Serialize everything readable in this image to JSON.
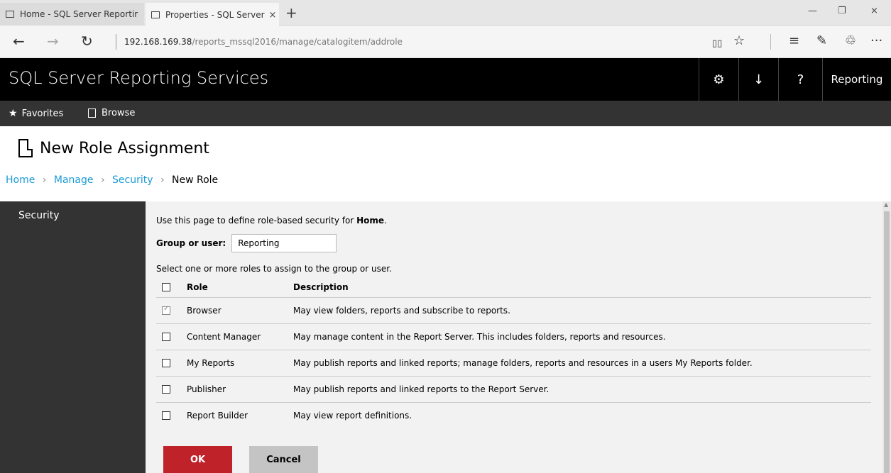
{
  "browser": {
    "tabs": [
      {
        "title": "Home - SQL Server Reportir"
      },
      {
        "title": "Properties - SQL Server",
        "close": "×"
      }
    ],
    "new_tab": "+",
    "window": {
      "minimize": "—",
      "restore": "❐",
      "close": "×"
    },
    "nav": {
      "back": "←",
      "forward": "→",
      "refresh": "↻"
    },
    "url_host": "192.168.169.38",
    "url_path": "/reports_mssql2016/manage/catalogitem/addrole",
    "toolbar": {
      "reading": "▯▯",
      "favorite": "☆",
      "hub": "≡",
      "notes": "✎",
      "share": "♲",
      "more": "···"
    }
  },
  "app": {
    "title": "SQL Server Reporting Services",
    "header": {
      "settings": "⚙",
      "download": "↓",
      "help": "?",
      "user": "Reporting"
    },
    "nav": {
      "favorites": "Favorites",
      "favorites_icon": "★",
      "browse": "Browse"
    }
  },
  "page": {
    "title": "New Role Assignment",
    "breadcrumb": {
      "home": "Home",
      "manage": "Manage",
      "security": "Security",
      "current": "New Role",
      "separator": "›"
    }
  },
  "sidebar": {
    "items": [
      {
        "label": "Security"
      }
    ]
  },
  "form": {
    "intro_prefix": "Use this page to define role-based security for ",
    "intro_item": "Home",
    "intro_suffix": ".",
    "group_label": "Group or user:",
    "group_value": "Reporting",
    "select_text": "Select one or more roles to assign to the group or user.",
    "columns": {
      "role": "Role",
      "description": "Description"
    },
    "roles": [
      {
        "name": "Browser",
        "description": "May view folders, reports and subscribe to reports.",
        "checked": true
      },
      {
        "name": "Content Manager",
        "description": "May manage content in the Report Server. This includes folders, reports and resources.",
        "checked": false
      },
      {
        "name": "My Reports",
        "description": "May publish reports and linked reports; manage folders, reports and resources in a users My Reports folder.",
        "checked": false
      },
      {
        "name": "Publisher",
        "description": "May publish reports and linked reports to the Report Server.",
        "checked": false
      },
      {
        "name": "Report Builder",
        "description": "May view report definitions.",
        "checked": false
      }
    ],
    "ok_label": "OK",
    "cancel_label": "Cancel"
  },
  "colors": {
    "accent_red": "#c0222a",
    "link_blue": "#1a9ad6",
    "header_black": "#000000",
    "nav_gray": "#333333"
  }
}
